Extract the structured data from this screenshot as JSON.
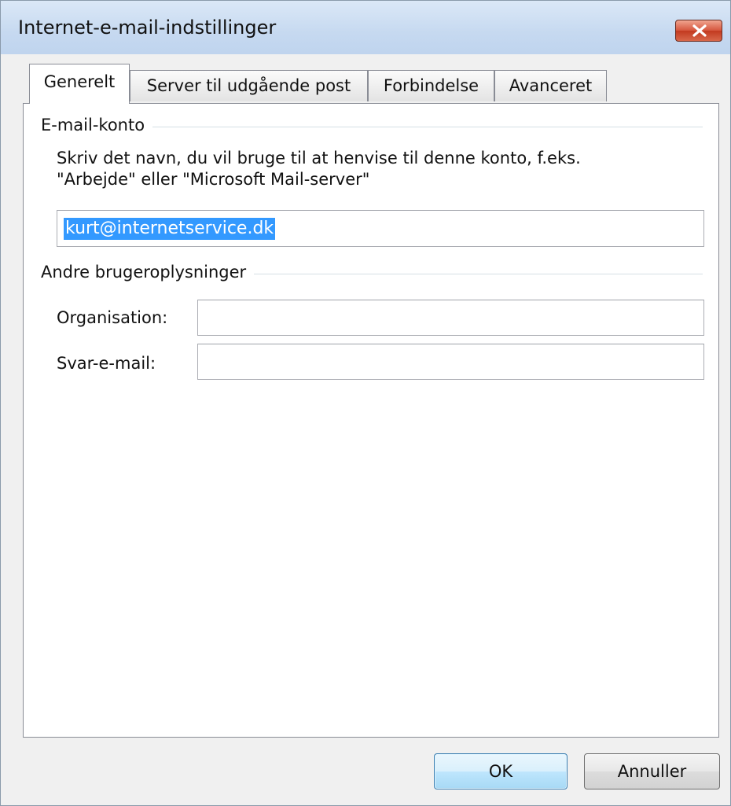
{
  "window": {
    "title": "Internet-e-mail-indstillinger"
  },
  "tabs": [
    {
      "label": "Generelt",
      "active": true
    },
    {
      "label": "Server til udgående post",
      "active": false
    },
    {
      "label": "Forbindelse",
      "active": false
    },
    {
      "label": "Avanceret",
      "active": false
    }
  ],
  "email_account": {
    "group_title": "E-mail-konto",
    "description_line1": "Skriv det navn, du vil bruge til at henvise til denne konto, f.eks.",
    "description_line2": "\"Arbejde\" eller \"Microsoft Mail-server\"",
    "account_name_value": "kurt@internetservice.dk"
  },
  "user_info": {
    "group_title": "Andre brugeroplysninger",
    "organisation_label": "Organisation:",
    "organisation_value": "",
    "reply_email_label": "Svar-e-mail:",
    "reply_email_value": ""
  },
  "buttons": {
    "ok_label": "OK",
    "cancel_label": "Annuller"
  },
  "colors": {
    "titlebar": "#c6d9f0",
    "close_button": "#d5553c",
    "selection": "#3399ff",
    "default_button_border": "#3c7fb1"
  },
  "icons": {
    "close": "close-icon"
  }
}
